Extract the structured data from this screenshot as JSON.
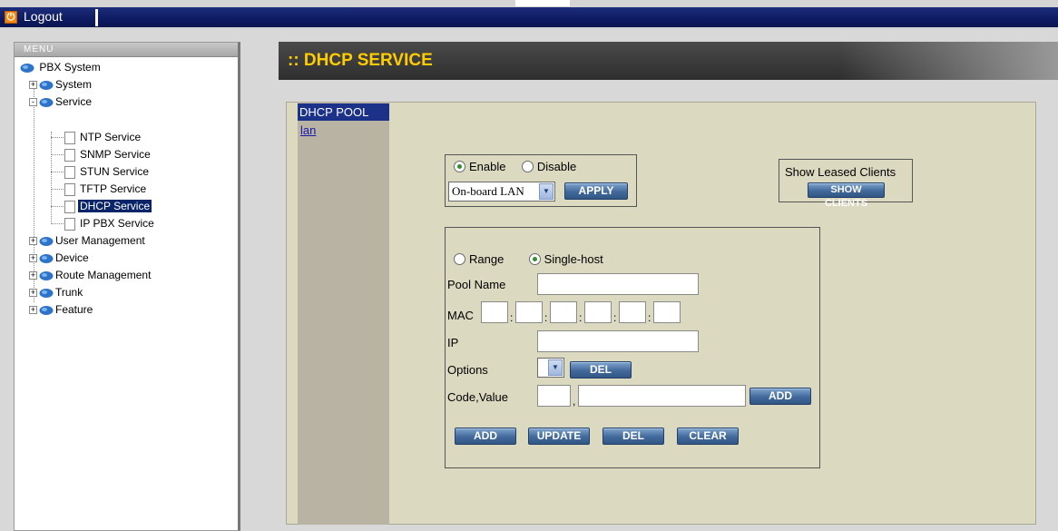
{
  "topbar": {
    "logout_label": "Logout"
  },
  "sidebar": {
    "menu_label": "MENU",
    "root": "PBX System",
    "items": [
      {
        "label": "System",
        "expand": "+"
      },
      {
        "label": "Service",
        "expand": "-"
      },
      {
        "label": "NTP Service"
      },
      {
        "label": "SNMP Service"
      },
      {
        "label": "STUN Service"
      },
      {
        "label": "TFTP Service"
      },
      {
        "label": "DHCP Service",
        "selected": true
      },
      {
        "label": "IP PBX Service"
      },
      {
        "label": "User Management",
        "expand": "+"
      },
      {
        "label": "Device",
        "expand": "+"
      },
      {
        "label": "Route Management",
        "expand": "+"
      },
      {
        "label": "Trunk",
        "expand": "+"
      },
      {
        "label": "Feature",
        "expand": "+"
      }
    ]
  },
  "header": {
    "title": ":: DHCP SERVICE"
  },
  "pool": {
    "heading": "DHCP POOL",
    "link": "lan"
  },
  "service": {
    "enable_label": "Enable",
    "disable_label": "Disable",
    "interface_value": "On-board LAN",
    "apply_label": "APPLY"
  },
  "clients": {
    "label": "Show Leased Clients",
    "button": "SHOW CLIENTS"
  },
  "form": {
    "range_label": "Range",
    "single_label": "Single-host",
    "pool_name_label": "Pool Name",
    "mac_label": "MAC",
    "ip_label": "IP",
    "options_label": "Options",
    "options_del": "DEL",
    "code_value_label": "Code,Value",
    "code_sep": ",",
    "code_add": "ADD",
    "add_label": "ADD",
    "update_label": "UPDATE",
    "del_label": "DEL",
    "clear_label": "CLEAR"
  },
  "colors": {
    "accent_title": "#ffcc00",
    "selected_bg": "#0a246a",
    "panel_bg": "#dbd9c0"
  }
}
